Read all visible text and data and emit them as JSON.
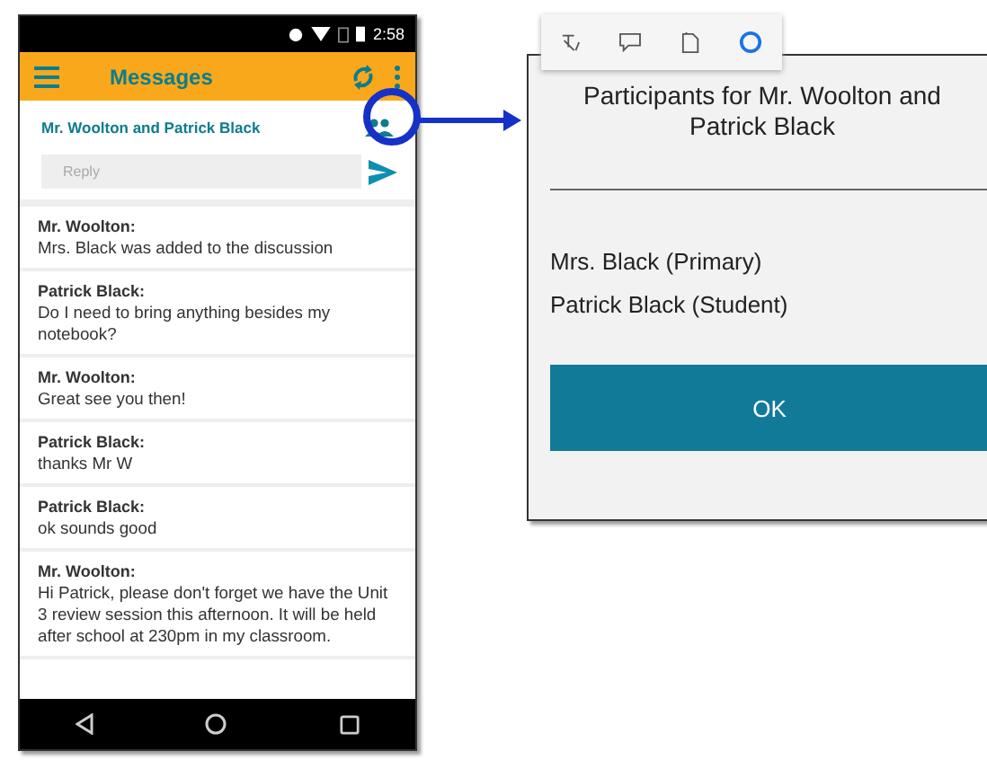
{
  "phone": {
    "status_bar": {
      "time": "2:58"
    },
    "app_bar": {
      "title": "Messages"
    },
    "conversation": {
      "title": "Mr. Woolton and Patrick Black",
      "reply": {
        "placeholder": "Reply"
      }
    },
    "messages": [
      {
        "sender": "Mr. Woolton:",
        "text": "Mrs. Black was added to the discussion"
      },
      {
        "sender": "Patrick Black:",
        "text": "Do I need to bring anything besides my notebook?"
      },
      {
        "sender": "Mr. Woolton:",
        "text": "Great see you then!"
      },
      {
        "sender": "Patrick Black:",
        "text": "thanks Mr W"
      },
      {
        "sender": "Patrick Black:",
        "text": "ok sounds good"
      },
      {
        "sender": "Mr. Woolton:",
        "text": "Hi Patrick, please don't forget we have the Unit 3 review session this afternoon. It will be held after school at 230pm in my classroom."
      }
    ]
  },
  "text_toolbar": {
    "items": [
      {
        "kind": "translate"
      },
      {
        "kind": "comment"
      },
      {
        "kind": "copy"
      },
      {
        "kind": "circle"
      }
    ]
  },
  "dialog": {
    "title": "Participants for Mr. Woolton and Patrick Black",
    "participants": [
      "Mrs. Black (Primary)",
      "Patrick Black (Student)"
    ],
    "button": "OK"
  }
}
